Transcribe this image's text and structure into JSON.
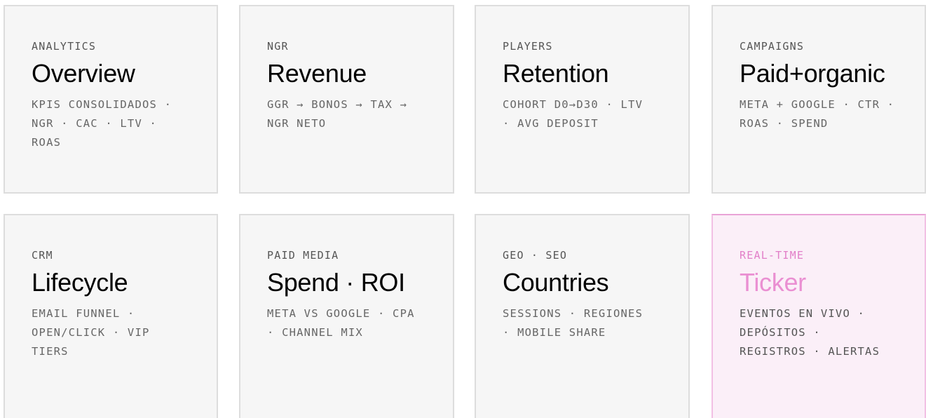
{
  "cards": [
    {
      "label": "ANALYTICS",
      "title": "Overview",
      "desc": "KPIS CONSOLIDADOS · NGR · CAC · LTV · ROAS"
    },
    {
      "label": "NGR",
      "title": "Revenue",
      "desc": "GGR → BONOS → TAX → NGR NETO"
    },
    {
      "label": "PLAYERS",
      "title": "Retention",
      "desc": "COHORT D0→D30 · LTV · AVG DEPOSIT"
    },
    {
      "label": "CAMPAIGNS",
      "title": "Paid+organic",
      "desc": "META + GOOGLE · CTR · ROAS · SPEND"
    },
    {
      "label": "CRM",
      "title": "Lifecycle",
      "desc": "EMAIL FUNNEL · OPEN/CLICK · VIP TIERS"
    },
    {
      "label": "PAID MEDIA",
      "title": "Spend · ROI",
      "desc": "META VS GOOGLE · CPA · CHANNEL MIX"
    },
    {
      "label": "GEO · SEO",
      "title": "Countries",
      "desc": "SESSIONS · REGIONES · MOBILE SHARE"
    },
    {
      "label": "REAL-TIME",
      "title": "Ticker",
      "desc": "EVENTOS EN VIVO · DEPÓSITOS · REGISTROS · ALERTAS",
      "active": true
    }
  ],
  "colors": {
    "card_bg": "#f6f6f6",
    "card_border": "#dddddd",
    "active_accent": "#ea8fd2",
    "active_bg": "#fbeff8"
  }
}
